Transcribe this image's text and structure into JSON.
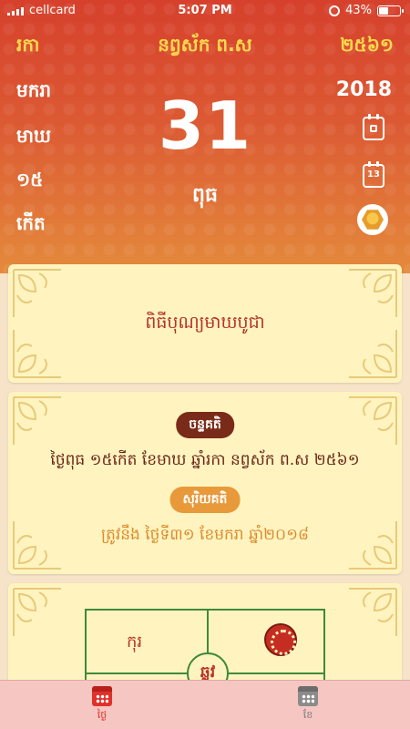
{
  "status_bar": {
    "carrier": "cellcard",
    "time": "5:07 PM",
    "battery": "43%"
  },
  "header": {
    "left_top": "រកា",
    "title": "នព្វស័ក ព.ស",
    "right_top": "២៥៦១",
    "left_labels": [
      "មករា",
      "មាឃ",
      "១៥",
      "កើត"
    ],
    "year": "2018",
    "day_number": "31",
    "weekday": "ពុធ",
    "icons": [
      "calendar-today-icon",
      "calendar-13-icon",
      "buddha-icon"
    ],
    "calendar_icon_day": "13"
  },
  "event_card": {
    "title": "ពិធីបុណ្យមាឃបូជា"
  },
  "info_card": {
    "lunar_badge": "ចន្ទគតិ",
    "lunar_text": "ថ្ងៃពុធ ១៥កើត ខែមាឃ ឆ្នាំរកា នព្វស័ក ព.ស ២៥៦១",
    "solar_badge": "សុរិយគតិ",
    "solar_text": "ត្រូវនឹង ថ្ងៃទី៣១ ខែមករា ឆ្នាំ២០១៨"
  },
  "chart_card": {
    "cell_top_left": "កុរ",
    "center": "ឆ្លូវ",
    "icons": [
      "snake-zodiac-icon"
    ]
  },
  "tabbar": {
    "tabs": [
      {
        "label": "ថ្ងៃ",
        "active": true,
        "icon": "calendar-icon"
      },
      {
        "label": "ខែ",
        "active": false,
        "icon": "calendar-grid-icon"
      }
    ]
  },
  "colors": {
    "header_red": "#d6402c",
    "header_yellow": "#ffd84d",
    "card_bg": "#fff4bf",
    "text_red": "#b8322a",
    "badge_dark": "#7a2a18",
    "badge_orange": "#e8993a",
    "green": "#3f8a3a",
    "tabbar_bg": "#f5c6c2"
  }
}
